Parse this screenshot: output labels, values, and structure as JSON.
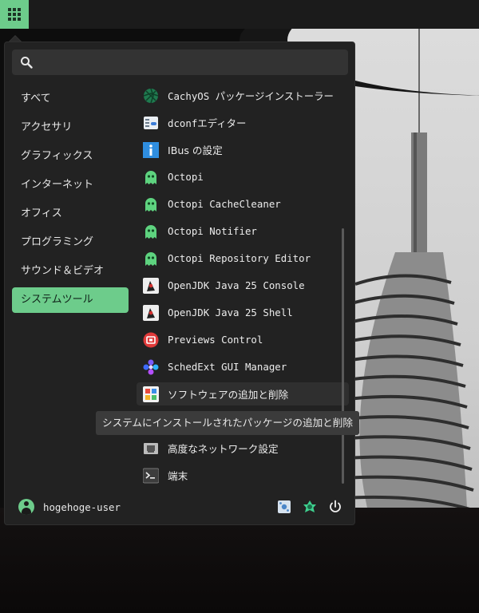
{
  "search": {
    "placeholder": "",
    "value": ""
  },
  "categories": [
    {
      "label": "すべて"
    },
    {
      "label": "アクセサリ"
    },
    {
      "label": "グラフィックス"
    },
    {
      "label": "インターネット"
    },
    {
      "label": "オフィス"
    },
    {
      "label": "プログラミング"
    },
    {
      "label": "サウンド＆ビデオ"
    },
    {
      "label": "システムツール",
      "active": true
    }
  ],
  "apps": [
    {
      "label": "CachyOS パッケージインストーラー",
      "icon": "cachyos-icon"
    },
    {
      "label": "dconfエディター",
      "icon": "dconf-editor-icon"
    },
    {
      "label": "IBus の設定",
      "icon": "info-icon"
    },
    {
      "label": "Octopi",
      "icon": "octopi-ghost-icon"
    },
    {
      "label": "Octopi CacheCleaner",
      "icon": "octopi-ghost-icon"
    },
    {
      "label": "Octopi Notifier",
      "icon": "octopi-ghost-icon"
    },
    {
      "label": "Octopi Repository Editor",
      "icon": "octopi-ghost-icon"
    },
    {
      "label": "OpenJDK Java 25 Console",
      "icon": "java-duke-icon"
    },
    {
      "label": "OpenJDK Java 25 Shell",
      "icon": "java-duke-icon"
    },
    {
      "label": "Previews Control",
      "icon": "previews-control-icon"
    },
    {
      "label": "SchedExt GUI Manager",
      "icon": "schedext-icon"
    },
    {
      "label": "ソフトウェアの追加と削除",
      "icon": "software-store-icon"
    },
    {
      "label": "高度なネットワーク設定",
      "icon": "network-icon"
    },
    {
      "label": "端末",
      "icon": "terminal-icon"
    }
  ],
  "tooltip": "システムにインストールされたパッケージの追加と削除",
  "user": {
    "name": "hogehoge-user"
  },
  "colors": {
    "accent": "#6dcc8b",
    "menu_bg": "#222222",
    "search_bg": "#333333"
  }
}
